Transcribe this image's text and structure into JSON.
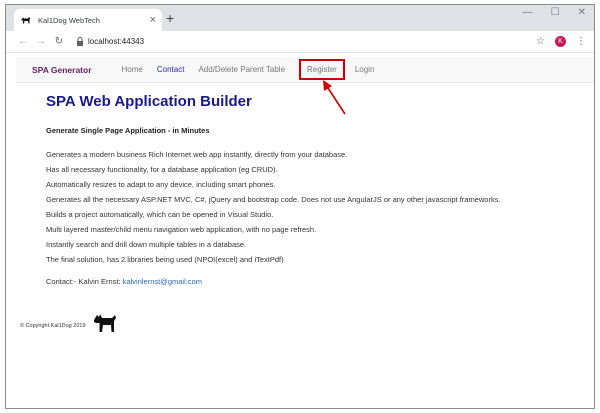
{
  "browser": {
    "tab_title": "Kal1Dog WebTech",
    "tab_close": "×",
    "new_tab": "+",
    "url": "localhost:44343",
    "profile_initial": "K"
  },
  "site": {
    "brand": "SPA Generator",
    "nav": [
      "Home",
      "Contact",
      "Add/Delete Parent Table",
      "Register",
      "Login"
    ],
    "active_nav": "Contact",
    "highlighted_nav": "Register"
  },
  "main": {
    "title": "SPA Web Application Builder",
    "subtitle": "Generate Single Page Application - in Minutes",
    "features": [
      "Generates a modern business Rich Internet web app instantly, directly from your database.",
      "Has all necessary functionality, for a database application (eg CRUD).",
      "Automatically resizes to adapt to any device, including smart phones.",
      "Generates all the necessary ASP.NET MVC, C#, jQuery and bootstrap code. Does not use AngularJS or any other javascript frameworks.",
      "Builds a project automatically, which can be opened in Visual Studio.",
      "Multi layered master/child menu navigation web application, with no page refresh.",
      "Instantly search and drill down multiple tables in a database.",
      "The final solution, has 2 libraries being used (NPOI(excel) and iTextPdf)"
    ],
    "contact_label": "Contact:- Kalvin Ernst:",
    "contact_email": "kalvinlernst@gmail.com"
  },
  "footer": {
    "copyright": "© Copyright Kal1Dog 2019"
  },
  "colors": {
    "brand": "#6a1b6a",
    "title": "#1a1a8c",
    "highlight": "#cc0000",
    "link": "#2a6ab0"
  }
}
